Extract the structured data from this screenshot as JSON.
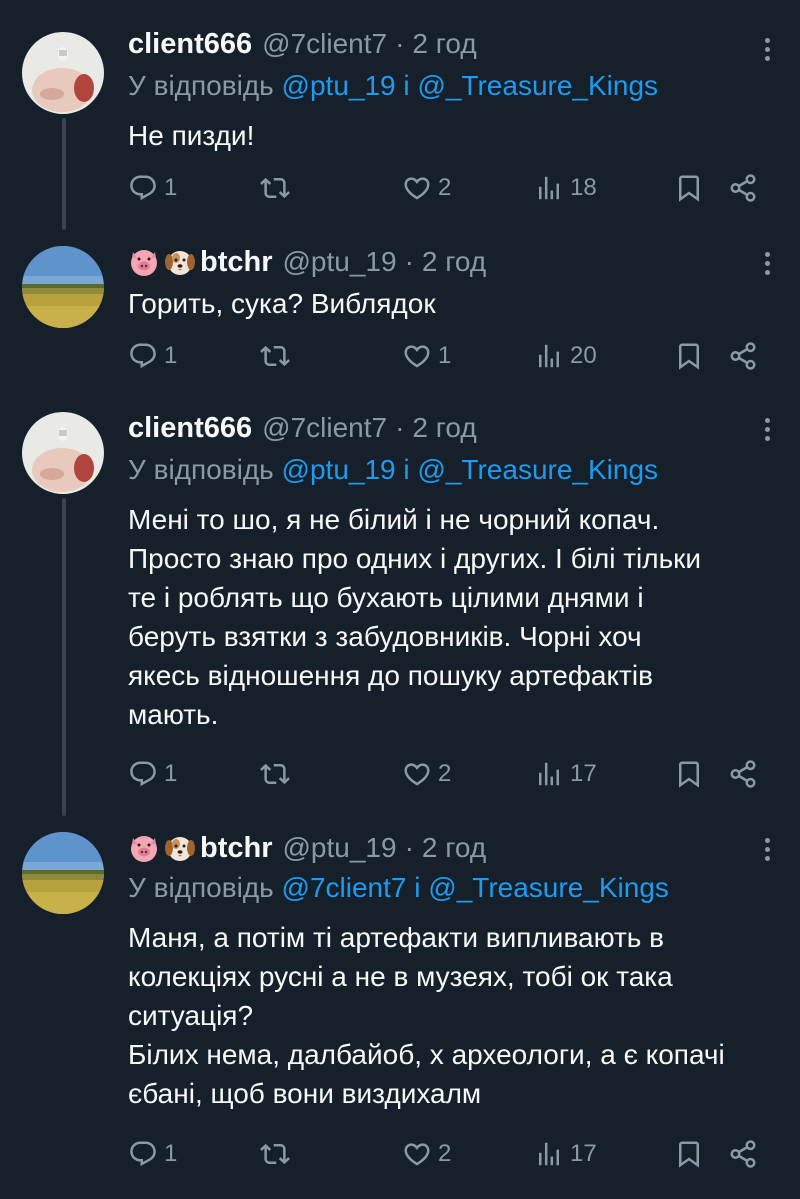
{
  "tweets": [
    {
      "name": "client666",
      "handle": "@7client7",
      "sep": "·",
      "time": "2 год",
      "reply_prefix": "У відповідь",
      "reply_user1": "@ptu_19",
      "reply_and": "і",
      "reply_user2": "@_Treasure_Kings",
      "text": "Не пизди!",
      "replies": "1",
      "retweets": "",
      "likes": "2",
      "views": "18",
      "avatar_icon": "baby-head-avatar"
    },
    {
      "name": "btchr",
      "handle": "@ptu_19",
      "sep": "·",
      "time": "2 год",
      "text": "Горить, сука? Виблядок",
      "replies": "1",
      "retweets": "",
      "likes": "1",
      "views": "20",
      "avatar_icon": "field-landscape-avatar",
      "name_emojis": [
        "pig-face-emoji",
        "dog-face-emoji"
      ]
    },
    {
      "name": "client666",
      "handle": "@7client7",
      "sep": "·",
      "time": "2 год",
      "reply_prefix": "У відповідь",
      "reply_user1": "@ptu_19",
      "reply_and": "і",
      "reply_user2": "@_Treasure_Kings",
      "text_lines": [
        "Мені то шо, я не білий і не чорний копач.",
        "Просто знаю про одних і других. І білі тільки",
        "те і роблять що бухають цілими днями і",
        "беруть взятки з забудовників. Чорні хоч",
        "якесь відношення до пошуку артефактів",
        "мають."
      ],
      "replies": "1",
      "retweets": "",
      "likes": "2",
      "views": "17",
      "avatar_icon": "baby-head-avatar"
    },
    {
      "name": "btchr",
      "handle": "@ptu_19",
      "sep": "·",
      "time": "2 год",
      "reply_prefix": "У відповідь",
      "reply_user1": "@7client7",
      "reply_and": "і",
      "reply_user2": "@_Treasure_Kings",
      "text_lines": [
        "Маня, а потім ті артефакти випливають в",
        "колекціях русні а не в музеях, тобі ок така",
        "ситуація?",
        "Білих нема, далбайоб, х археологи, а є копачі",
        "єбані, щоб вони виздихалм"
      ],
      "replies": "1",
      "retweets": "",
      "likes": "2",
      "views": "17",
      "avatar_icon": "field-landscape-avatar",
      "name_emojis": [
        "pig-face-emoji",
        "dog-face-emoji"
      ]
    }
  ],
  "colors": {
    "background": "#15202b",
    "text": "#f7f9f9",
    "muted": "#8b98a5",
    "link": "#1d9bf0",
    "thread_line": "#38444d"
  }
}
